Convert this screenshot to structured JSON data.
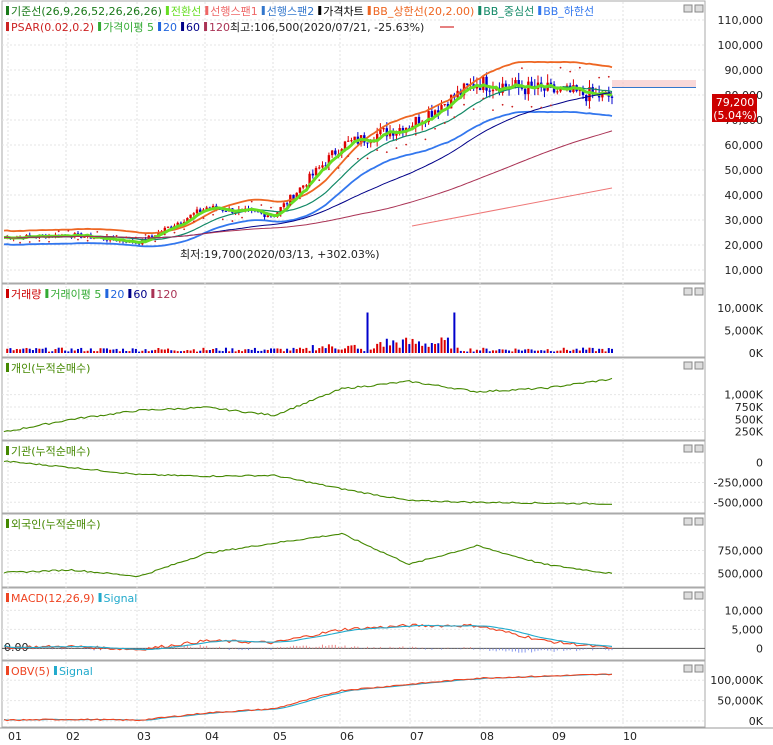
{
  "x_axis": {
    "months": [
      "01",
      "02",
      "03",
      "04",
      "05",
      "06",
      "07",
      "08",
      "09",
      "10"
    ]
  },
  "panels": {
    "price": {
      "legend_line1": [
        {
          "text": "기준선(26,9,26,52,26,26,26)",
          "color": "#1a7a1a"
        },
        {
          "text": "전환선",
          "color": "#66dd22"
        },
        {
          "text": "선행스팬1",
          "color": "#ee6666"
        },
        {
          "text": "선행스팬2",
          "color": "#3377cc"
        },
        {
          "text": "가격차트",
          "color": "#000000"
        },
        {
          "text": "BB_상한선(20,2.00)",
          "color": "#ee6622"
        },
        {
          "text": "BB_중심선",
          "color": "#118866"
        },
        {
          "text": "BB_하한선",
          "color": "#3377ee"
        }
      ],
      "legend_line2": [
        {
          "text": "PSAR(0.02,0.2)",
          "color": "#cc2222"
        },
        {
          "text": "가격이평 5",
          "color": "#33aa33"
        },
        {
          "text": "20",
          "color": "#2266dd"
        },
        {
          "text": "60",
          "color": "#000088"
        },
        {
          "text": "120",
          "color": "#aa3355"
        }
      ],
      "max_annotation": "최고:106,500(2020/07/21, -25.63%)",
      "min_annotation": "최저:19,700(2020/03/13, +302.03%)",
      "current_price": "79,200",
      "current_change": "(5.04%)",
      "y_ticks": [
        "110,000",
        "100,000",
        "90,000",
        "80,000",
        "70,000",
        "60,000",
        "50,000",
        "40,000",
        "30,000",
        "20,000",
        "10,000"
      ]
    },
    "volume": {
      "legend": [
        {
          "text": "거래량",
          "color": "#cc0000"
        },
        {
          "text": "거래이평 5",
          "color": "#33aa33"
        },
        {
          "text": "20",
          "color": "#2266dd"
        },
        {
          "text": "60",
          "color": "#000088"
        },
        {
          "text": "120",
          "color": "#aa3355"
        }
      ],
      "y_ticks": [
        "10,000K",
        "5,000K",
        "0K"
      ]
    },
    "individual": {
      "legend": [
        {
          "text": "개인(누적순매수)",
          "color": "#448800"
        }
      ],
      "y_ticks": [
        "1,000K",
        "750K",
        "500K",
        "250K"
      ]
    },
    "institution": {
      "legend": [
        {
          "text": "기관(누적순매수)",
          "color": "#448800"
        }
      ],
      "y_ticks": [
        "0",
        "-250,000",
        "-500,000"
      ]
    },
    "foreign": {
      "legend": [
        {
          "text": "외국인(누적순매수)",
          "color": "#448800"
        }
      ],
      "y_ticks": [
        "750,000",
        "500,000"
      ]
    },
    "macd": {
      "legend": [
        {
          "text": "MACD(12,26,9)",
          "color": "#ee4422"
        },
        {
          "text": "Signal",
          "color": "#22aacc"
        }
      ],
      "left_label": "0.00",
      "y_ticks": [
        "10,000",
        "5,000",
        "0"
      ]
    },
    "obv": {
      "legend": [
        {
          "text": "OBV(5)",
          "color": "#ee4422"
        },
        {
          "text": "Signal",
          "color": "#22aacc"
        }
      ],
      "y_ticks": [
        "100,000K",
        "50,000K",
        "0K"
      ]
    }
  },
  "colors": {
    "up": "#dd0000",
    "down": "#0000cc",
    "grid": "#d0d0d0",
    "border": "#999999"
  },
  "chart_data": {
    "type": "line",
    "title": "",
    "x": [
      "01",
      "02",
      "03",
      "04",
      "05",
      "06",
      "07",
      "08",
      "09",
      "10"
    ],
    "series": [
      {
        "name": "가격차트",
        "values": [
          23000,
          24000,
          21000,
          35000,
          32000,
          60000,
          68000,
          85000,
          82000,
          79200
        ]
      },
      {
        "name": "개인(누적순매수)",
        "values": [
          240000,
          500000,
          680000,
          740000,
          580000,
          1120000,
          1270000,
          1060000,
          1130000,
          1320000
        ]
      },
      {
        "name": "기관(누적순매수)",
        "values": [
          20000,
          -60000,
          -150000,
          -170000,
          -160000,
          -330000,
          -480000,
          -500000,
          -510000,
          -520000
        ]
      },
      {
        "name": "외국인(누적순매수)",
        "values": [
          510000,
          540000,
          470000,
          720000,
          830000,
          930000,
          600000,
          800000,
          600000,
          500000
        ]
      },
      {
        "name": "MACD(12,26,9)",
        "values": [
          300,
          500,
          -300,
          2000,
          1500,
          5000,
          6000,
          6000,
          2000,
          0
        ]
      },
      {
        "name": "OBV(5)",
        "values": [
          2000,
          4000,
          2000,
          20000,
          30000,
          75000,
          90000,
          105000,
          110000,
          115000
        ]
      }
    ],
    "ylim": [
      10000,
      110000
    ]
  }
}
